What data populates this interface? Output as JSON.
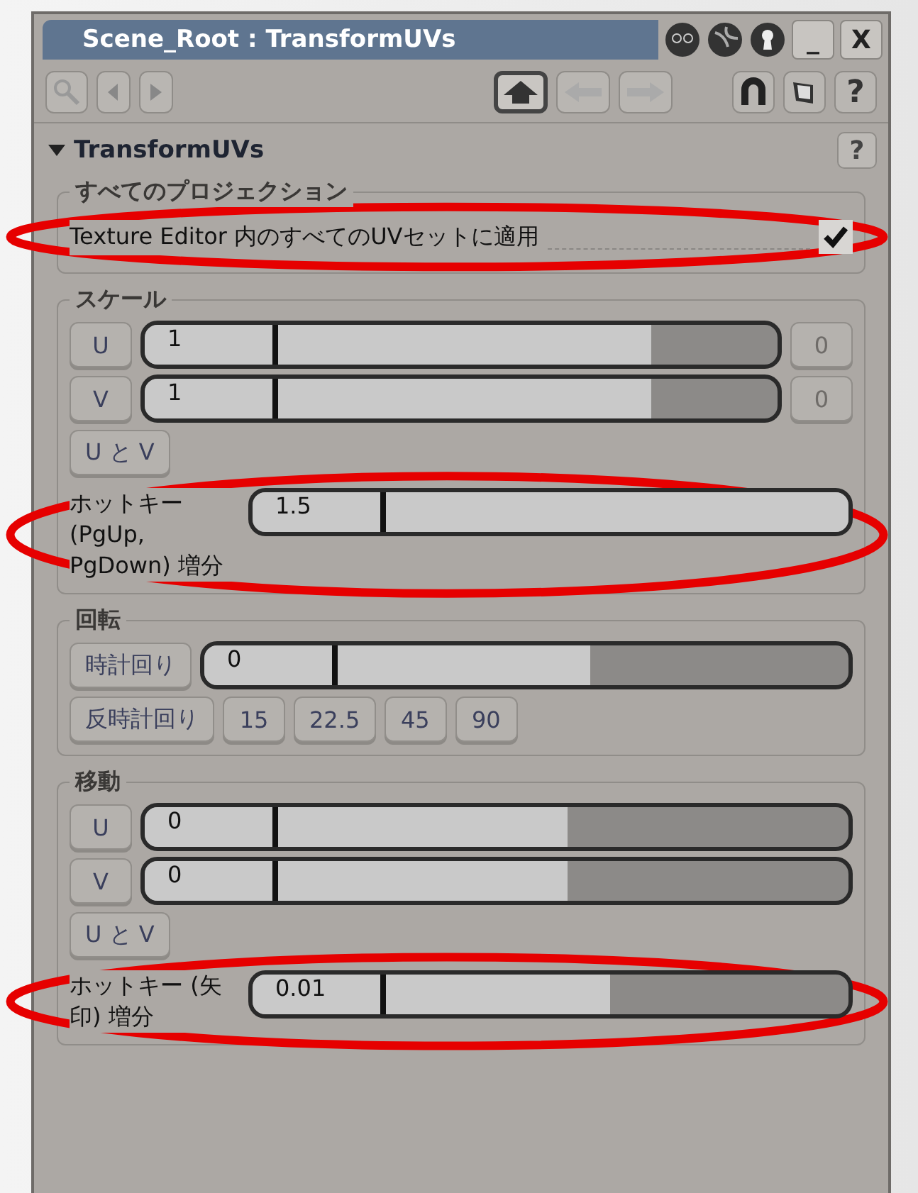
{
  "window": {
    "title": "Scene_Root : TransformUVs",
    "controls": [
      "_",
      "X"
    ]
  },
  "toolbar": {
    "help": "?"
  },
  "panel": {
    "title": "TransformUVs",
    "expanded": true,
    "help": "?"
  },
  "groups": [
    {
      "title": "すべてのプロジェクション",
      "rows": [
        {
          "kind": "checkbox",
          "label": "Texture Editor 内のすべてのUVセットに適用",
          "checked": true,
          "circled": true
        }
      ]
    },
    {
      "title": "スケール",
      "rows": [
        {
          "kind": "slider",
          "button": "U",
          "value": "1",
          "level": 0.8,
          "side": "0",
          "circled": false
        },
        {
          "kind": "slider",
          "button": "V",
          "value": "1",
          "level": 0.8,
          "side": "0",
          "circled": false
        },
        {
          "kind": "buttons",
          "buttons": [
            "U と V"
          ],
          "circled": false
        },
        {
          "kind": "labeled-slider",
          "label": "ホットキー (PgUp, PgDown) 増分",
          "value": "1.5",
          "level": 1,
          "circled": true
        }
      ]
    },
    {
      "title": "回転",
      "rows": [
        {
          "kind": "slider",
          "button": "時計回り",
          "value": "0",
          "level": 0.6,
          "circled": false
        },
        {
          "kind": "buttons",
          "buttons": [
            "反時計回り",
            "15",
            "22.5",
            "45",
            "90"
          ],
          "circled": false
        }
      ]
    },
    {
      "title": "移動",
      "rows": [
        {
          "kind": "slider",
          "button": "U",
          "value": "0",
          "level": 0.6,
          "circled": false
        },
        {
          "kind": "slider",
          "button": "V",
          "value": "0",
          "level": 0.6,
          "circled": false
        },
        {
          "kind": "buttons",
          "buttons": [
            "U と V"
          ],
          "circled": false
        },
        {
          "kind": "labeled-slider",
          "label": "ホットキー (矢印) 増分",
          "value": "0.01",
          "level": 0.6,
          "circled": true
        }
      ]
    }
  ]
}
